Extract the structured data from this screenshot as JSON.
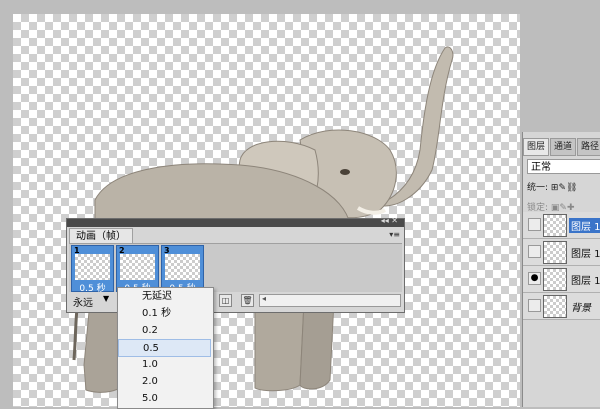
{
  "animation_panel": {
    "tab_label": "动画（帧）",
    "frames": [
      {
        "number": "1",
        "delay": "0.5 秒"
      },
      {
        "number": "2",
        "delay": "0.5 秒"
      },
      {
        "number": "3",
        "delay": "0.5 秒"
      }
    ],
    "loop_label": "永远"
  },
  "delay_menu": {
    "items": [
      "无延迟",
      "0.1 秒",
      "0.2",
      "0.5",
      "1.0",
      "2.0",
      "5.0"
    ],
    "highlighted": "0.5"
  },
  "layers_panel": {
    "tabs": [
      "图层",
      "通道",
      "路径"
    ],
    "blend_mode": "正常",
    "lock_row": "统一:",
    "lock_label": "锁定:",
    "layers": [
      {
        "name": "图层 1",
        "selected": true
      },
      {
        "name": "图层 1",
        "selected": false
      },
      {
        "name": "图层 1",
        "selected": false
      },
      {
        "name": "背景",
        "selected": false
      }
    ]
  },
  "colors": {
    "selection_blue": "#4f8fd8",
    "highlight_blue": "#3a74c9"
  }
}
